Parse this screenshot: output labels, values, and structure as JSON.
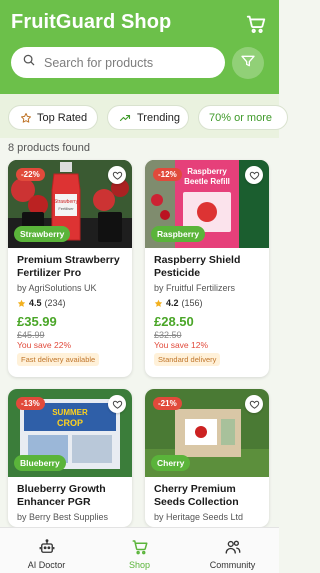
{
  "header": {
    "title": "FruitGuard Shop",
    "cart_icon": "cart-icon",
    "filter_icon": "filter-icon",
    "color": "#6cc04a"
  },
  "search": {
    "placeholder": "Search for products",
    "icon": "search-icon"
  },
  "chips": [
    {
      "label": "Top Rated",
      "icon": "star-outline-icon"
    },
    {
      "label": "Trending",
      "icon": "trending-up-icon"
    },
    {
      "label": "70% or more"
    }
  ],
  "results": {
    "count_text": "8 products found"
  },
  "products": [
    {
      "discount": "-22%",
      "category": "Strawberry",
      "name": "Premium Strawberry Fertilizer Pro",
      "brand": "by AgriSolutions UK",
      "rating": "4.5",
      "reviews": "(234)",
      "price": "£35.99",
      "old_price": "£45.99",
      "save": "You save 22%",
      "delivery": "Fast delivery available"
    },
    {
      "discount": "-12%",
      "category": "Raspberry",
      "name": "Raspberry Shield Pesticide",
      "brand": "by Fruitful Fertilizers",
      "rating": "4.2",
      "reviews": "(156)",
      "price": "£28.50",
      "old_price": "£32.50",
      "save": "You save 12%",
      "delivery": "Standard delivery",
      "image_text_1": "Raspberry",
      "image_text_2": "Beetle Refill"
    },
    {
      "discount": "-13%",
      "category": "Blueberry",
      "name": "Blueberry Growth Enhancer PGR",
      "brand": "by Berry Best Supplies",
      "image_text_1": "SUMMER",
      "image_text_2": "CROP"
    },
    {
      "discount": "-21%",
      "category": "Cherry",
      "name": "Cherry Premium Seeds Collection",
      "brand": "by Heritage Seeds Ltd"
    }
  ],
  "nav": [
    {
      "label": "AI Doctor",
      "icon": "robot-icon",
      "active": false
    },
    {
      "label": "Shop",
      "icon": "cart-icon",
      "active": true
    },
    {
      "label": "Community",
      "icon": "people-icon",
      "active": false
    }
  ],
  "colors": {
    "accent": "#5ab43a",
    "price": "#4aa628",
    "discount": "#e14a3b"
  }
}
